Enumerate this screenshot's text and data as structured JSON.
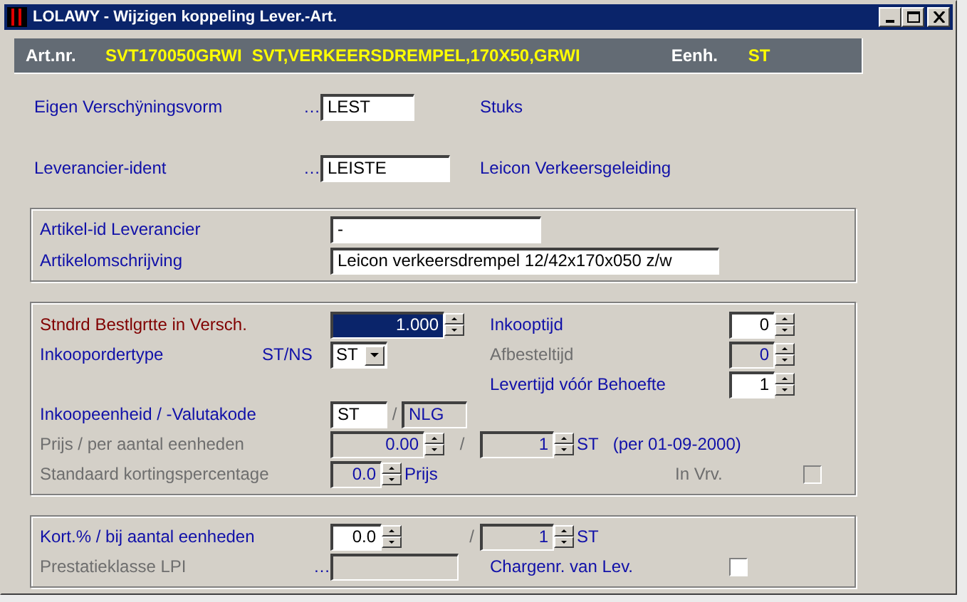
{
  "window": {
    "title": "LOLAWY - Wijzigen koppeling Lever.-Art."
  },
  "header": {
    "art_label": "Art.nr.",
    "art_code": "SVT170050GRWI",
    "art_name": "SVT,VERKEERSDREMPEL,170X50,GRWI",
    "unit_label": "Eenh.",
    "unit": "ST"
  },
  "identity": [
    {
      "label": "Eigen Verschÿningsvorm",
      "lookup": "…",
      "value": "LEST",
      "description": "Stuks"
    },
    {
      "label": "Leverancier-ident",
      "lookup": "…",
      "value": "LEISTE",
      "description": "Leicon Verkeersgeleiding"
    }
  ],
  "supplier_article": [
    {
      "label": "Artikel-id Leverancier",
      "value": "-"
    },
    {
      "label": "Artikelomschrijving",
      "value": "Leicon verkeersdrempel 12/42x170x050 z/w"
    }
  ],
  "order": {
    "standard_size": {
      "label": "Stndrd Bestlgrtte in Versch.",
      "value": "1.000",
      "focused": true
    },
    "order_type": {
      "label": "Inkoopordertype",
      "hint": "ST/NS",
      "value": "ST"
    },
    "times": [
      {
        "label": "Inkooptijd",
        "value": "0",
        "disabled": false
      },
      {
        "label": "Afbesteltijd",
        "value": "0",
        "disabled": true
      },
      {
        "label": "Levertijd vóór Behoefte",
        "value": "1",
        "disabled": false
      }
    ],
    "unit_currency": {
      "label": "Inkoopeenheid / -Valutakode",
      "unit": "ST",
      "separator": "/",
      "currency": "NLG"
    },
    "price": {
      "label": "Prijs / per aantal eenheden",
      "disabled": true,
      "value": "0.00",
      "separator": "/",
      "quantity": "1",
      "unit": "ST",
      "date_note": "(per 01-09-2000)"
    },
    "discount": {
      "label": "Standaard kortingspercentage",
      "disabled": true,
      "value": "0.0",
      "suffix": "Prijs"
    },
    "in_vrv": {
      "label": "In Vrv.",
      "disabled": true,
      "checked": false
    }
  },
  "quantity_discount": {
    "label": "Kort.% / bij aantal eenheden",
    "value": "0.0",
    "separator": "/",
    "quantity": "1",
    "quantity_disabled": true,
    "unit": "ST",
    "lpi": {
      "label": "Prestatieklasse LPI",
      "lookup": "…",
      "disabled": true
    },
    "batch": {
      "label": "Chargenr. van Lev.",
      "checked": false
    }
  }
}
